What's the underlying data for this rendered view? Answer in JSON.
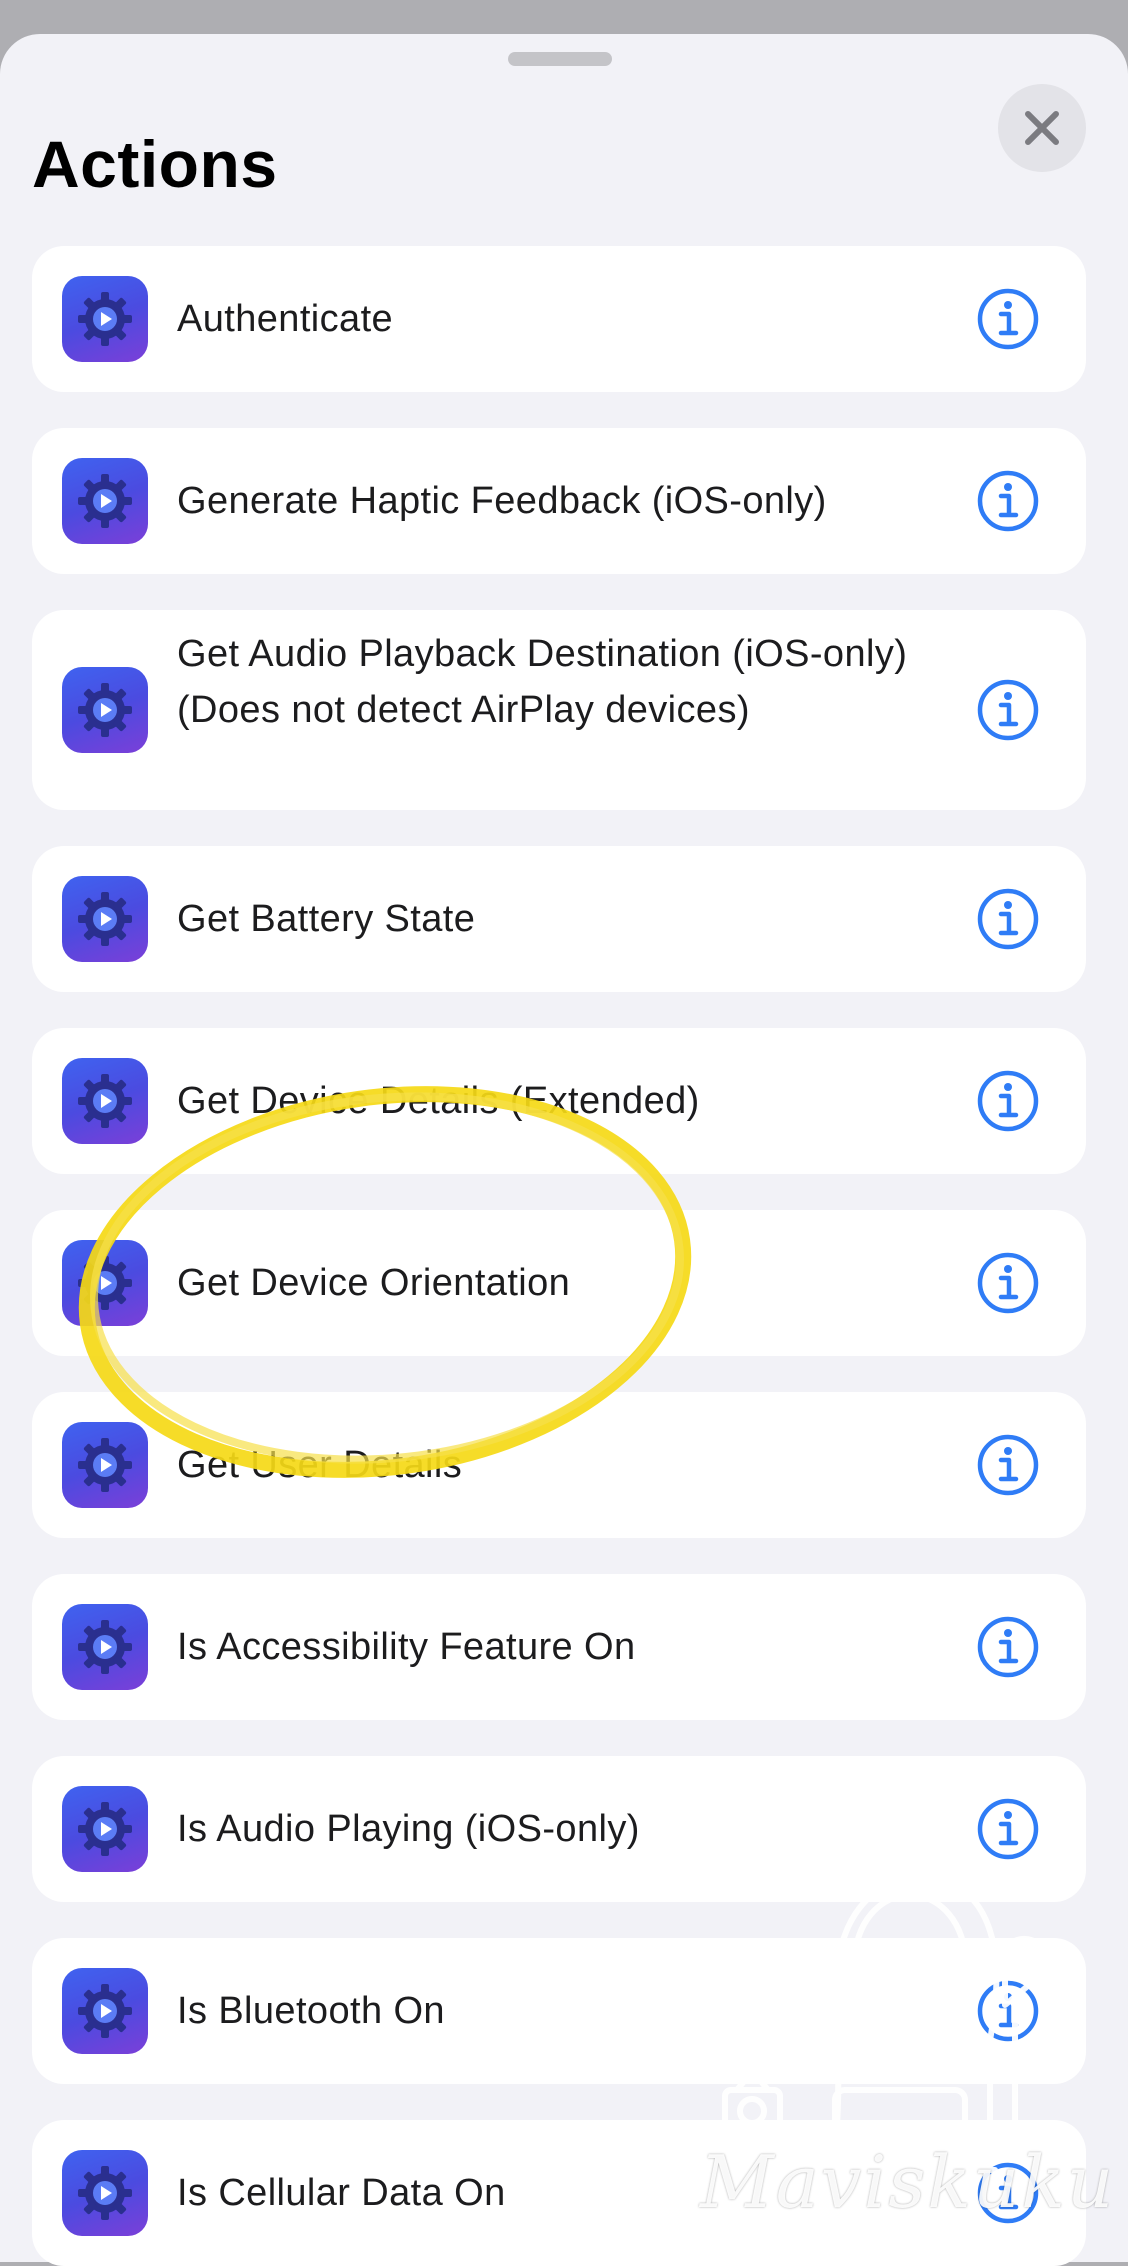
{
  "sheet": {
    "title": "Actions",
    "close_icon": "xmark-icon"
  },
  "actions": [
    {
      "label": "Authenticate",
      "icon": "gear-play-icon",
      "info_icon": "info-icon"
    },
    {
      "label": "Generate Haptic Feedback (iOS-only)",
      "icon": "gear-play-icon",
      "info_icon": "info-icon"
    },
    {
      "label": "Get Audio Playback Destination (iOS-only) (Does not detect AirPlay devices)",
      "icon": "gear-play-icon",
      "info_icon": "info-icon"
    },
    {
      "label": "Get Battery State",
      "icon": "gear-play-icon",
      "info_icon": "info-icon"
    },
    {
      "label": "Get Device Details (Extended)",
      "icon": "gear-play-icon",
      "info_icon": "info-icon"
    },
    {
      "label": "Get Device Orientation",
      "icon": "gear-play-icon",
      "info_icon": "info-icon"
    },
    {
      "label": "Get User Details",
      "icon": "gear-play-icon",
      "info_icon": "info-icon"
    },
    {
      "label": "Is Accessibility Feature On",
      "icon": "gear-play-icon",
      "info_icon": "info-icon"
    },
    {
      "label": "Is Audio Playing (iOS-only)",
      "icon": "gear-play-icon",
      "info_icon": "info-icon"
    },
    {
      "label": "Is Bluetooth On",
      "icon": "gear-play-icon",
      "info_icon": "info-icon"
    },
    {
      "label": "Is Cellular Data On",
      "icon": "gear-play-icon",
      "info_icon": "info-icon"
    }
  ],
  "overlay": {
    "highlight_color": "#f5d916",
    "highlight_target": "Get Device Orientation"
  },
  "watermark": {
    "text": "Maviskuku"
  },
  "colors": {
    "accent": "#2f7cf6",
    "icon_gradient_start": "#3f63f0",
    "icon_gradient_end": "#7b3fd8"
  }
}
